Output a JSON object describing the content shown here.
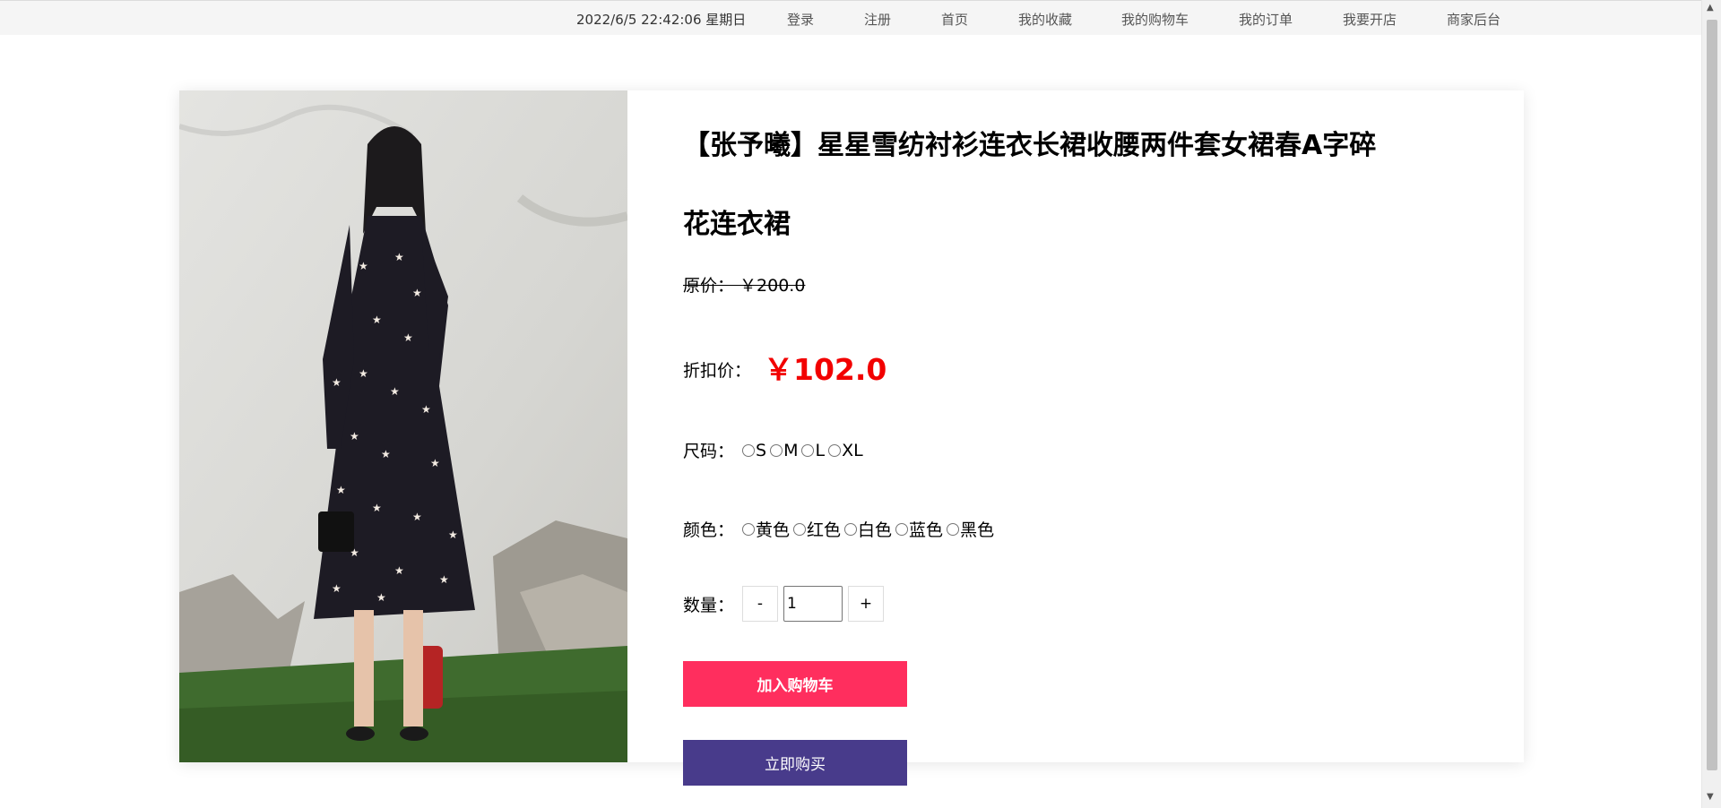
{
  "topbar": {
    "datetime": "2022/6/5 22:42:06 星期日",
    "nav": [
      "登录",
      "注册",
      "首页",
      "我的收藏",
      "我的购物车",
      "我的订单",
      "我要开店",
      "商家后台"
    ]
  },
  "product": {
    "title": "【张予曦】星星雪纺衬衫连衣长裙收腰两件套女裙春A字碎花连衣裙",
    "original_price": "原价：  ￥200.0",
    "discount_label": "折扣价：",
    "discount_price": "￥102.0",
    "image_alt": "product-photo",
    "size_label": "尺码：",
    "sizes": [
      "S",
      "M",
      "L",
      "XL"
    ],
    "color_label": "颜色：",
    "colors": [
      "黄色",
      "红色",
      "白色",
      "蓝色",
      "黑色"
    ],
    "quantity_label": "数量：",
    "minus": "-",
    "plus": "+",
    "quantity": "1",
    "add_to_cart": "加入购物车",
    "buy_now": "立即购买"
  },
  "colors": {
    "price_red": "#f20000",
    "cart_button": "#ff2e5e",
    "buy_button": "#483b8b"
  }
}
